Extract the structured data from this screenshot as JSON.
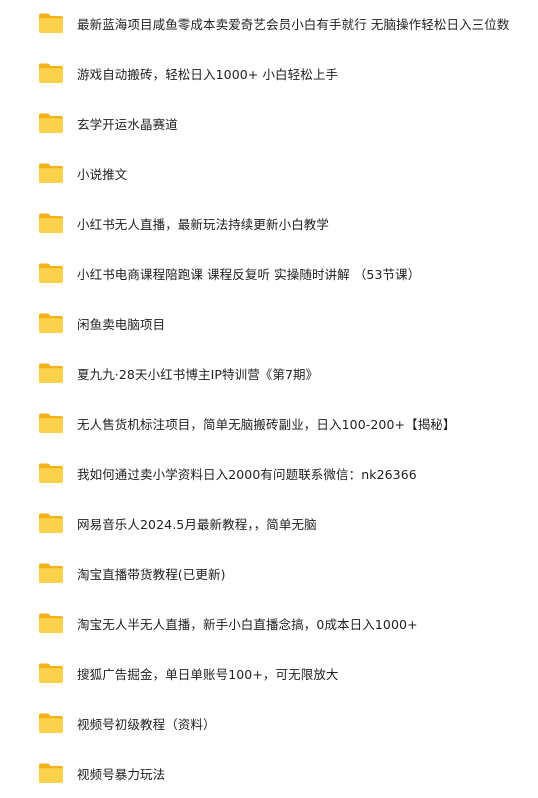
{
  "folders": [
    {
      "name": "最新蓝海项目咸鱼零成本卖爱奇艺会员小白有手就行 无脑操作轻松日入三位数",
      "icon": "folder-icon"
    },
    {
      "name": "游戏自动搬砖，轻松日入1000+ 小白轻松上手",
      "icon": "folder-icon"
    },
    {
      "name": "玄学开运水晶赛道",
      "icon": "folder-icon"
    },
    {
      "name": "小说推文",
      "icon": "folder-icon"
    },
    {
      "name": "小红书无人直播，最新玩法持续更新小白教学",
      "icon": "folder-icon"
    },
    {
      "name": "小红书电商课程陪跑课 课程反复听 实操随时讲解 （53节课）",
      "icon": "folder-icon"
    },
    {
      "name": "闲鱼卖电脑项目",
      "icon": "folder-icon"
    },
    {
      "name": "夏九九·28天小红书博主IP特训营《第7期》",
      "icon": "folder-icon"
    },
    {
      "name": "无人售货机标注项目，简单无脑搬砖副业，日入100-200+【揭秘】",
      "icon": "folder-icon"
    },
    {
      "name": "我如何通过卖小学资料日入2000有问题联系微信：nk26366",
      "icon": "folder-icon"
    },
    {
      "name": "网易音乐人2024.5月最新教程，，简单无脑",
      "icon": "folder-icon"
    },
    {
      "name": "淘宝直播带货教程(已更新)",
      "icon": "folder-icon"
    },
    {
      "name": "淘宝无人半无人直播，新手小白直播念搞，0成本日入1000+",
      "icon": "folder-icon"
    },
    {
      "name": "搜狐广告掘金，单日单账号100+，可无限放大",
      "icon": "folder-icon"
    },
    {
      "name": "视频号初级教程（资料）",
      "icon": "folder-icon"
    },
    {
      "name": "视频号暴力玩法",
      "icon": "folder-icon"
    }
  ],
  "colors": {
    "folder_back": "#f2b21c",
    "folder_front": "#fcd24d",
    "text": "#1f1f1f"
  }
}
